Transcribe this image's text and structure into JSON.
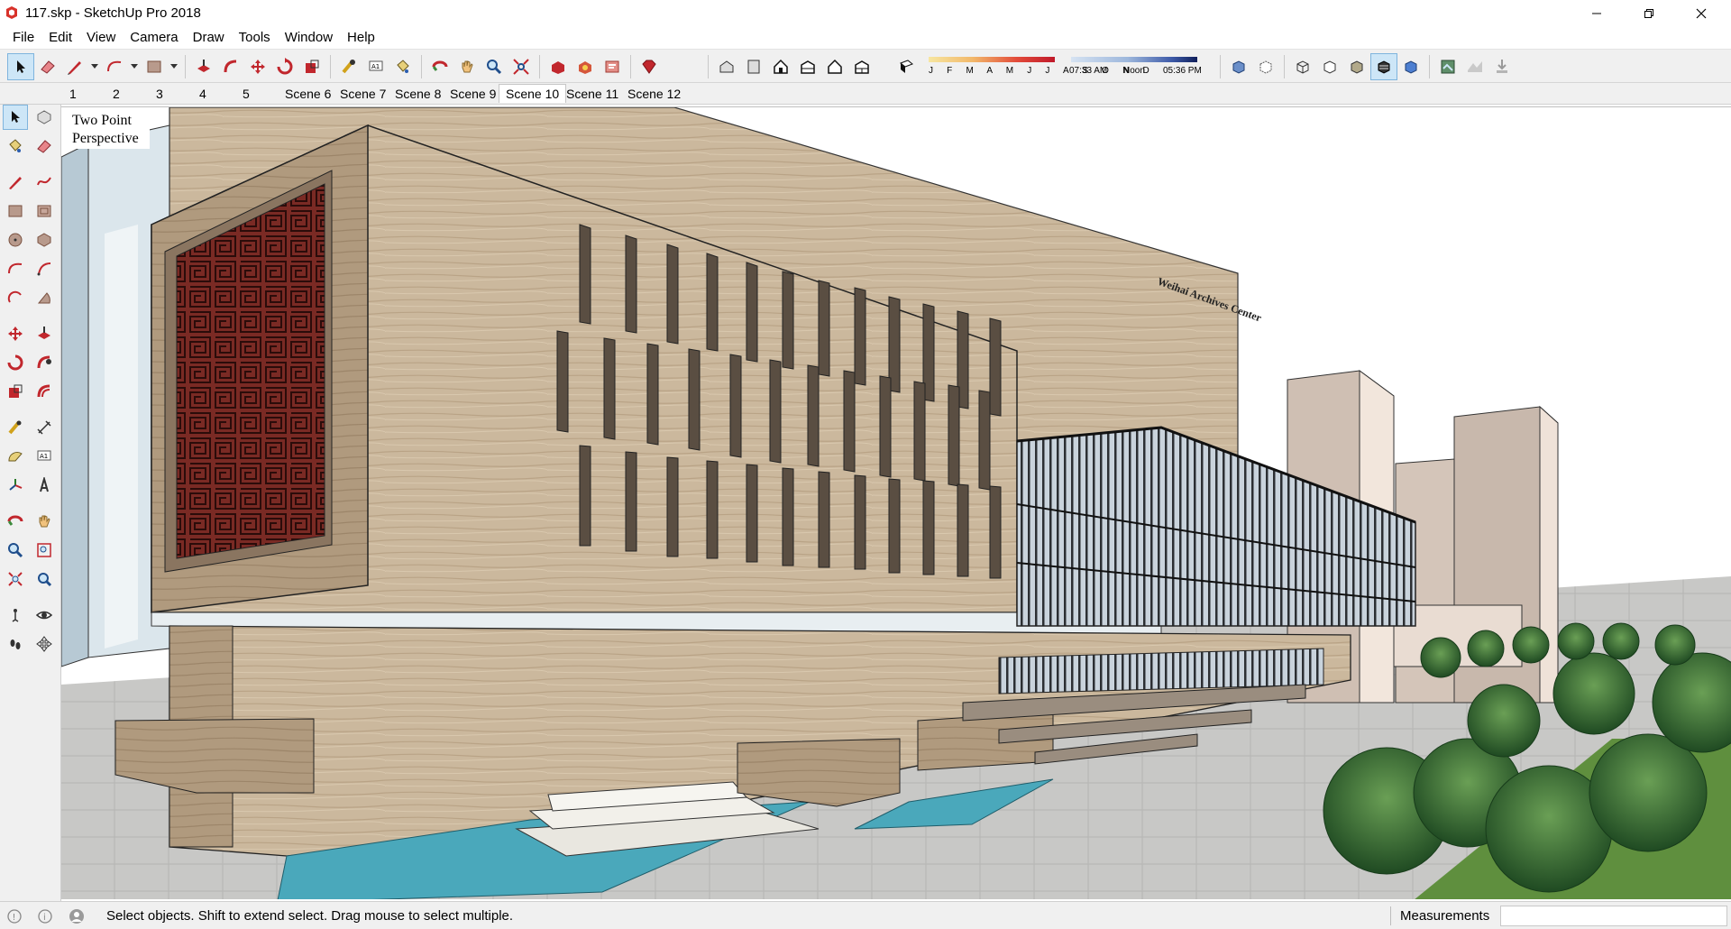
{
  "window": {
    "title": "117.skp - SketchUp Pro 2018",
    "controls": [
      "minimize",
      "restore",
      "close"
    ]
  },
  "menu": [
    "File",
    "Edit",
    "View",
    "Camera",
    "Draw",
    "Tools",
    "Window",
    "Help"
  ],
  "toolbar": {
    "shadow_months": "J F M A M J J A S O N D",
    "time_start": "07:33 AM",
    "time_mid": "Noon",
    "time_end": "05:36 PM"
  },
  "scenes": [
    "1",
    "2",
    "3",
    "4",
    "5",
    "Scene 6",
    "Scene 7",
    "Scene 8",
    "Scene 9",
    "Scene 10",
    "Scene 11",
    "Scene 12"
  ],
  "active_scene": "Scene 10",
  "viewport": {
    "view_label_line1": "Two Point",
    "view_label_line2": "Perspective",
    "building_sign": "Weihai Archives Center"
  },
  "status": {
    "message": "Select objects. Shift to extend select. Drag mouse to select multiple.",
    "measurements_label": "Measurements",
    "measurements_value": ""
  },
  "colors": {
    "ui_bg": "#f0f0f0",
    "selection_blue": "#cde6f7",
    "stone": "#cbb79c",
    "stone_dark": "#a8937a",
    "lattice_red": "#7a2a24",
    "water": "#4aa8bb",
    "sky": "#ffffff",
    "tree": "#3c7a3a"
  }
}
